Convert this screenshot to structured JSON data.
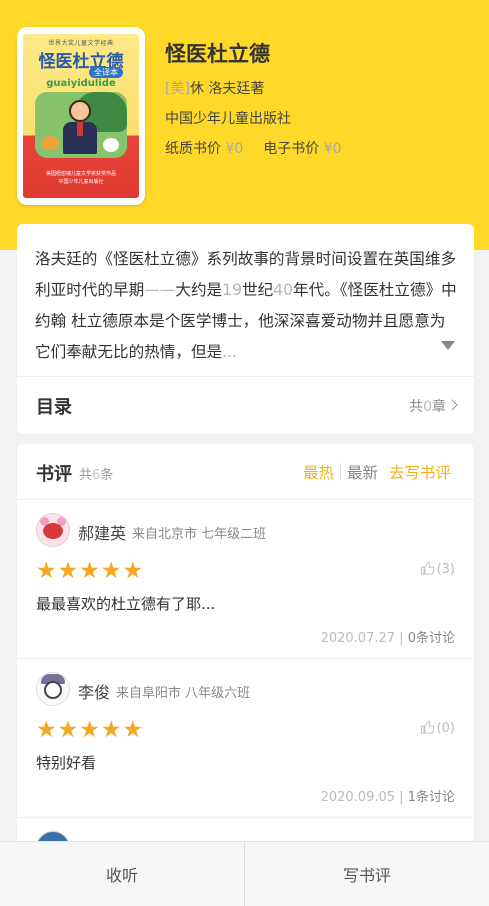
{
  "book": {
    "cover": {
      "series": "世界大奖儿童文学经典",
      "title": "怪医杜立德",
      "badge": "全译本",
      "pinyin": "guaiyidulide",
      "footer_line1": "美国纽伯瑞儿童文学奖获奖作品",
      "footer_line2": "中国少年儿童出版社"
    },
    "title": "怪医杜立德",
    "author_tag": "[美]",
    "author": "休 洛夫廷著",
    "publisher": "中国少年儿童出版社",
    "paper_price_label": "纸质书价",
    "paper_price": "¥0",
    "ebook_price_label": "电子书价",
    "ebook_price": "¥0"
  },
  "description": {
    "p1": "洛夫廷的《怪医杜立德》系列故事的背景时间设置在英国维多利亚时代的早期",
    "dashes": "——",
    "p2": "大约是",
    "n1": "19",
    "p3": "世纪",
    "n2": "40",
    "p4": "年代。《怪医杜立德》中约翰 杜立德原本是个医学博士，他深深喜爱动物并且愿意为它们奉献无比的热情，但是",
    "ellipsis": "..."
  },
  "toc": {
    "title": "目录",
    "count_prefix": "共",
    "count": "0",
    "count_suffix": "章"
  },
  "reviews": {
    "title": "书评",
    "total_prefix": "共",
    "total": "6",
    "total_suffix": "条",
    "sort_hot": "最热",
    "sort_new": "最新",
    "write_link": "去写书评",
    "items": [
      {
        "name": "郝建英",
        "location": "来自北京市 七年级二班",
        "stars": "★★★★★",
        "likes": "(3)",
        "text": "最最喜欢的杜立德有了耶...",
        "date": "2020.07.27",
        "sep": "|",
        "discussion_count": "0",
        "discussion_label": "条讨论"
      },
      {
        "name": "李俊",
        "location": "来自阜阳市 八年级六班",
        "stars": "★★★★★",
        "likes": "(0)",
        "text": "特别好看",
        "date": "2020.09.05",
        "sep": "|",
        "discussion_count": "1",
        "discussion_label": "条讨论"
      }
    ]
  },
  "bottom_bar": {
    "listen": "收听",
    "write_review": "写书评"
  },
  "colors": {
    "accent_yellow": "#fed92a",
    "star_orange": "#f5a623",
    "link_yellow": "#f0b418"
  }
}
